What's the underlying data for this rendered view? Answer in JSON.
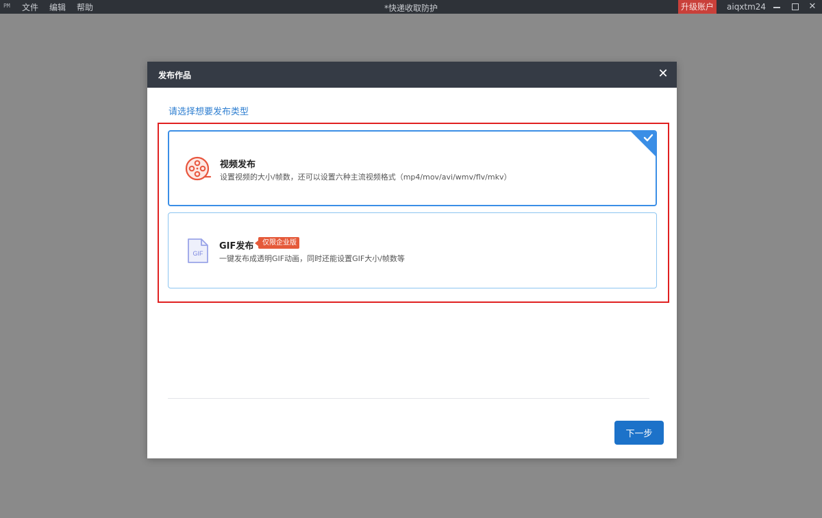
{
  "titlebar": {
    "logo": "PM",
    "menu": [
      "文件",
      "编辑",
      "帮助"
    ],
    "doc_title": "*快递收取防护",
    "upgrade_label": "升级账户",
    "username": "aiqxtm24",
    "close_glyph": "✕"
  },
  "modal": {
    "title": "发布作品",
    "close_glyph": "✕",
    "prompt": "请选择想要发布类型",
    "options": [
      {
        "name": "视频发布",
        "description": "设置视频的大小/帧数，还可以设置六种主流视频格式（mp4/mov/avi/wmv/flv/mkv）",
        "selected": true,
        "icon": "film-reel-icon"
      },
      {
        "name": "GIF发布",
        "badge": "仅限企业版",
        "description": "一键发布成透明GIF动画，同时还能设置GIF大小/帧数等",
        "selected": false,
        "icon": "gif-file-icon",
        "icon_text": "GIF"
      }
    ],
    "next_label": "下一步"
  },
  "colors": {
    "accent": "#1c72c9",
    "selected_border": "#3a8ee6",
    "highlight": "#e02020",
    "badge": "#e55a3a",
    "header": "#353b45"
  }
}
